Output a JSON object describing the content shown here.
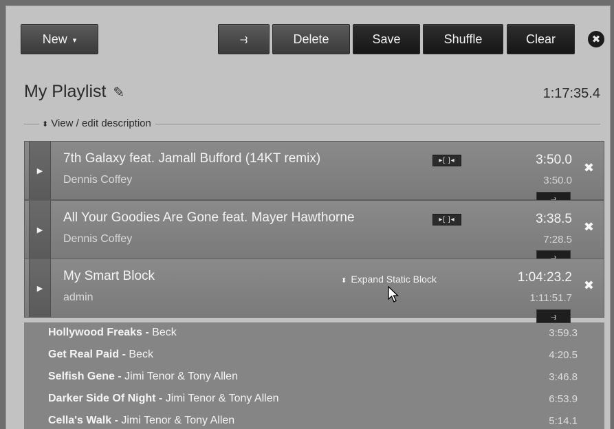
{
  "toolbar": {
    "new_label": "New",
    "new_caret": "▾",
    "crossfade_icon": "⥽",
    "delete_label": "Delete",
    "save_label": "Save",
    "shuffle_label": "Shuffle",
    "clear_label": "Clear",
    "close_icon": "✖"
  },
  "playlist": {
    "title": "My Playlist",
    "edit_icon": "✎",
    "total_length": "1:17:35.4",
    "description_toggle": "View / edit description",
    "description_icon": "⬍"
  },
  "tracks": [
    {
      "title": "7th Galaxy feat. Jamall Bufford (14KT remix)",
      "artist": "Dennis Coffey",
      "length": "3:50.0",
      "cumulative": "3:50.0",
      "cue_icon": "▸[ ]◂"
    },
    {
      "title": "All Your Goodies Are Gone feat. Mayer Hawthorne",
      "artist": "Dennis Coffey",
      "length": "3:38.5",
      "cumulative": "7:28.5",
      "cue_icon": "▸[ ]◂"
    },
    {
      "title": "My Smart Block",
      "artist": "admin",
      "length": "1:04:23.2",
      "cumulative": "1:11:51.7",
      "expand_label": "Expand Static Block",
      "expand_icon": "⬍"
    }
  ],
  "block_contents": [
    {
      "title": "Hollywood Freaks - ",
      "artist": "Beck",
      "length": "3:59.3"
    },
    {
      "title": "Get Real Paid - ",
      "artist": "Beck",
      "length": "4:20.5"
    },
    {
      "title": "Selfish Gene - ",
      "artist": "Jimi Tenor & Tony Allen",
      "length": "3:46.8"
    },
    {
      "title": "Darker Side Of Night - ",
      "artist": "Jimi Tenor & Tony Allen",
      "length": "6:53.9"
    },
    {
      "title": "Cella's Walk - ",
      "artist": "Jimi Tenor & Tony Allen",
      "length": "5:14.1"
    }
  ],
  "row_icons": {
    "play_icon": "▶",
    "remove_icon": "✖",
    "crossfade_icon": "⥽"
  },
  "colors": {
    "background": "#6e6e6e",
    "panel": "#c2c2c2",
    "button": "#4a4a4a",
    "row": "#828282"
  }
}
